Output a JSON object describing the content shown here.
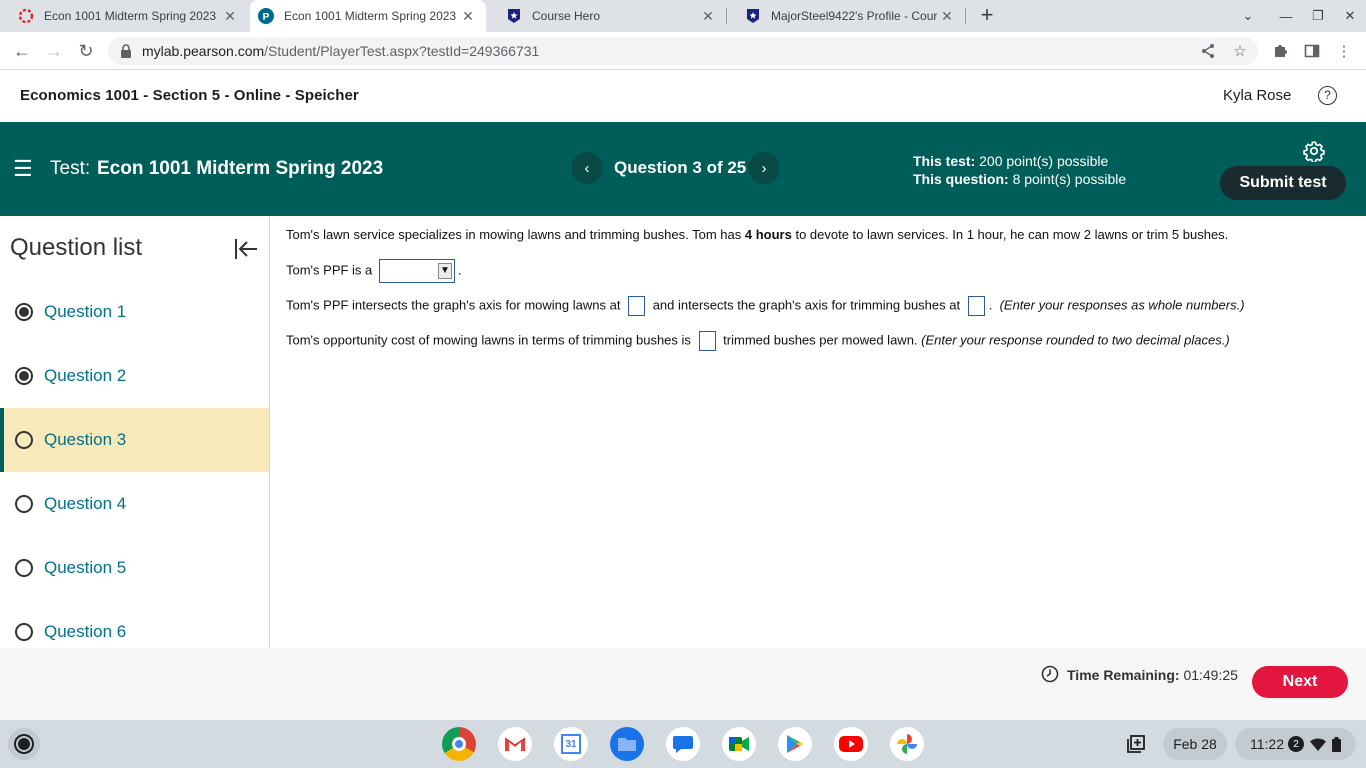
{
  "browser": {
    "tabs": [
      {
        "title": "Econ 1001 Midterm Spring 2023",
        "icon": "pearson-red-icon",
        "active": false
      },
      {
        "title": "Econ 1001 Midterm Spring 2023",
        "icon": "pearson-p-icon",
        "active": true
      },
      {
        "title": "Course Hero",
        "icon": "coursehero-icon",
        "active": false
      },
      {
        "title": "MajorSteel9422's Profile - Cours",
        "icon": "coursehero-icon",
        "active": false
      }
    ],
    "url_host": "mylab.pearson.com",
    "url_path": "/Student/PlayerTest.aspx?testId=249366731"
  },
  "course": {
    "title": "Economics 1001 - Section 5 - Online - Speicher",
    "user_name": "Kyla Rose"
  },
  "banner": {
    "test_label": "Test:",
    "test_name": "Econ 1001 Midterm Spring 2023",
    "question_counter": "Question 3 of 25",
    "this_test_label": "This test:",
    "this_test_value": "200 point(s) possible",
    "this_question_label": "This question:",
    "this_question_value": "8 point(s) possible",
    "submit_label": "Submit test",
    "colors": {
      "banner_bg": "#005e5a",
      "submit_bg": "#1a2b2f"
    }
  },
  "sidebar": {
    "heading": "Question list",
    "items": [
      {
        "label": "Question 1",
        "state": "answered"
      },
      {
        "label": "Question 2",
        "state": "answered"
      },
      {
        "label": "Question 3",
        "state": "current"
      },
      {
        "label": "Question 4",
        "state": "unanswered"
      },
      {
        "label": "Question 5",
        "state": "unanswered"
      },
      {
        "label": "Question 6",
        "state": "unanswered"
      }
    ]
  },
  "question": {
    "p1_pre": "Tom's lawn service specializes in mowing lawns and trimming bushes. Tom has ",
    "p1_bold": "4 hours",
    "p1_post": " to devote to lawn services. In 1 hour, he can mow 2 lawns or trim 5 bushes.",
    "p2_pre": "Tom's PPF is a",
    "p2_post": ".",
    "dropdown_value": "",
    "p3_pre": "Tom's PPF intersects the graph's axis for mowing lawns at",
    "p3_mid": "and intersects the graph's axis for trimming bushes at",
    "p3_post": ".",
    "p3_hint": "(Enter your responses as whole numbers.)",
    "p4_pre": "Tom's opportunity cost of mowing lawns in terms of trimming bushes is",
    "p4_post": "trimmed bushes per mowed lawn.",
    "p4_hint": "(Enter your response rounded to two decimal places.)"
  },
  "footer": {
    "time_label": "Time Remaining:",
    "time_value": "01:49:25",
    "next_label": "Next",
    "next_color": "#e3163f"
  },
  "shelf": {
    "apps": [
      "chrome-icon",
      "gmail-icon",
      "calendar-icon",
      "files-icon",
      "chat-icon",
      "meet-icon",
      "play-store-icon",
      "youtube-icon",
      "photos-icon"
    ],
    "calendar_day": "31",
    "date": "Feb 28",
    "time": "11:22",
    "notification_count": "2"
  }
}
